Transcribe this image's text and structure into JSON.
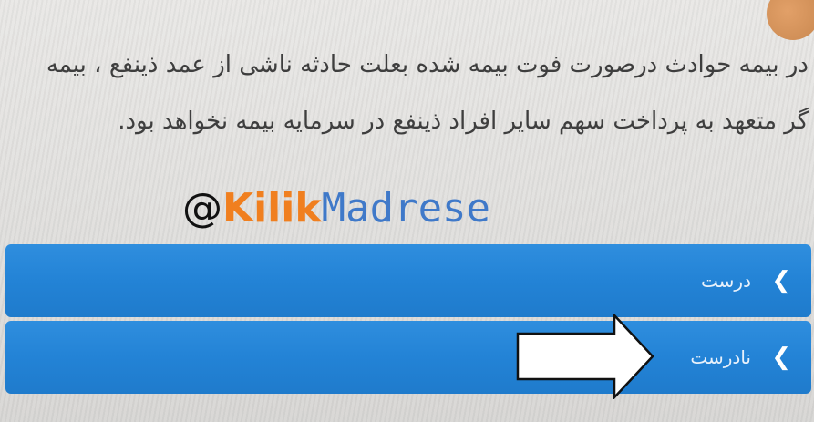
{
  "question": {
    "text": "در بیمه حوادث درصورت فوت بیمه شده بعلت حادثه ناشی از عمد ذینفع ، بیمه گر متعهد به پرداخت سهم سایر افراد ذینفع در سرمایه بیمه نخواهد بود."
  },
  "watermark": {
    "at": "@",
    "brand": "Kilik",
    "rest": "Madrese"
  },
  "options": [
    {
      "label": "درست",
      "icon": "chevron-left-icon"
    },
    {
      "label": "نادرست",
      "icon": "chevron-left-icon"
    }
  ],
  "colors": {
    "option_bg": "#2383d6",
    "watermark_brand": "#f07f1f",
    "watermark_rest": "#3f79c9",
    "text": "#3e3e3e"
  }
}
